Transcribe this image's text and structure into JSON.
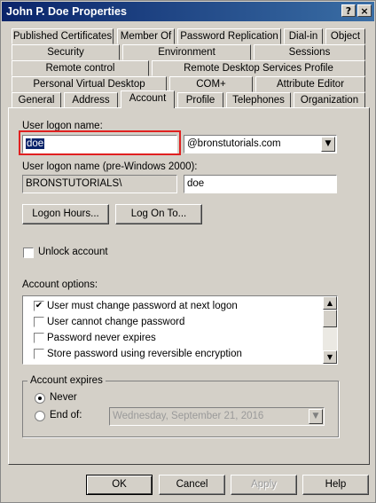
{
  "window": {
    "title": "John P. Doe Properties",
    "help_glyph": "?",
    "close_glyph": "×"
  },
  "tabs": {
    "row1": [
      "Published Certificates",
      "Member Of",
      "Password Replication",
      "Dial-in",
      "Object"
    ],
    "row2": [
      "Security",
      "Environment",
      "Sessions"
    ],
    "row3": [
      "Remote control",
      "Remote Desktop Services Profile"
    ],
    "row4": [
      "Personal Virtual Desktop",
      "COM+",
      "Attribute Editor"
    ],
    "row5": [
      "General",
      "Address",
      "Account",
      "Profile",
      "Telephones",
      "Organization"
    ],
    "active": "Account"
  },
  "account": {
    "logon_label": "User logon name:",
    "logon_value": "doe",
    "domain_value": "@bronstutorials.com",
    "pre2000_label": "User logon name (pre-Windows 2000):",
    "pre2000_domain": "BRONSTUTORIALS\\",
    "pre2000_user": "doe",
    "logon_hours_label": "Logon Hours...",
    "logon_to_label": "Log On To...",
    "unlock_label": "Unlock account",
    "options_label": "Account options:",
    "options": [
      {
        "label": "User must change password at next logon",
        "checked": true
      },
      {
        "label": "User cannot change password",
        "checked": false
      },
      {
        "label": "Password never expires",
        "checked": false
      },
      {
        "label": "Store password using reversible encryption",
        "checked": false
      }
    ],
    "expires_label": "Account expires",
    "never_label": "Never",
    "endof_label": "End of:",
    "endof_date": "Wednesday, September 21, 2016",
    "checkmark": "✔"
  },
  "footer": {
    "ok": "OK",
    "cancel": "Cancel",
    "apply": "Apply",
    "help": "Help"
  },
  "icons": {
    "dropdown": "▼",
    "up": "▲",
    "down": "▼"
  },
  "colors": {
    "title_start": "#0a246a",
    "title_end": "#3a6ea5",
    "highlight": "#e02020",
    "selection": "#0a246a"
  }
}
